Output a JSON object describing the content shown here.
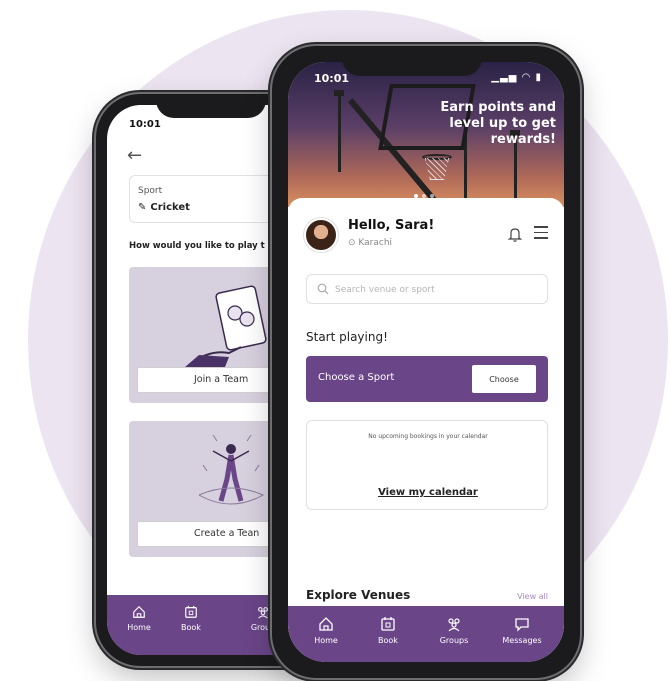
{
  "back_screen": {
    "time": "10:01",
    "sport_label": "Sport",
    "sport_value": "Cricket",
    "question": "How would you like to play t",
    "join_button": "Join a Team",
    "create_button": "Create a Tean",
    "tabs": [
      {
        "label": "Home",
        "icon": "home-icon"
      },
      {
        "label": "Book",
        "icon": "book-icon"
      },
      {
        "label": "Group",
        "icon": "groups-icon"
      }
    ]
  },
  "front_screen": {
    "time": "10:01",
    "hero": {
      "line1": "Earn points and",
      "line2": "level up to get",
      "line3": "rewards!"
    },
    "greeting": "Hello, Sara!",
    "location": "Karachi",
    "search_placeholder": "Search venue or sport",
    "start_title": "Start playing!",
    "choose_label": "Choose a Sport",
    "choose_button": "Choose",
    "calendar_empty": "No upcoming bookings in your calendar",
    "calendar_link": "View my calendar",
    "explore_title": "Explore Venues",
    "view_all": "View all",
    "tabs": [
      {
        "label": "Home",
        "icon": "home-icon"
      },
      {
        "label": "Book",
        "icon": "book-icon"
      },
      {
        "label": "Groups",
        "icon": "groups-icon"
      },
      {
        "label": "Messages",
        "icon": "message-icon"
      }
    ]
  },
  "colors": {
    "brand_purple": "#6a4588",
    "background_circle": "#ece4f1",
    "card_lavender": "#d7d0de"
  }
}
